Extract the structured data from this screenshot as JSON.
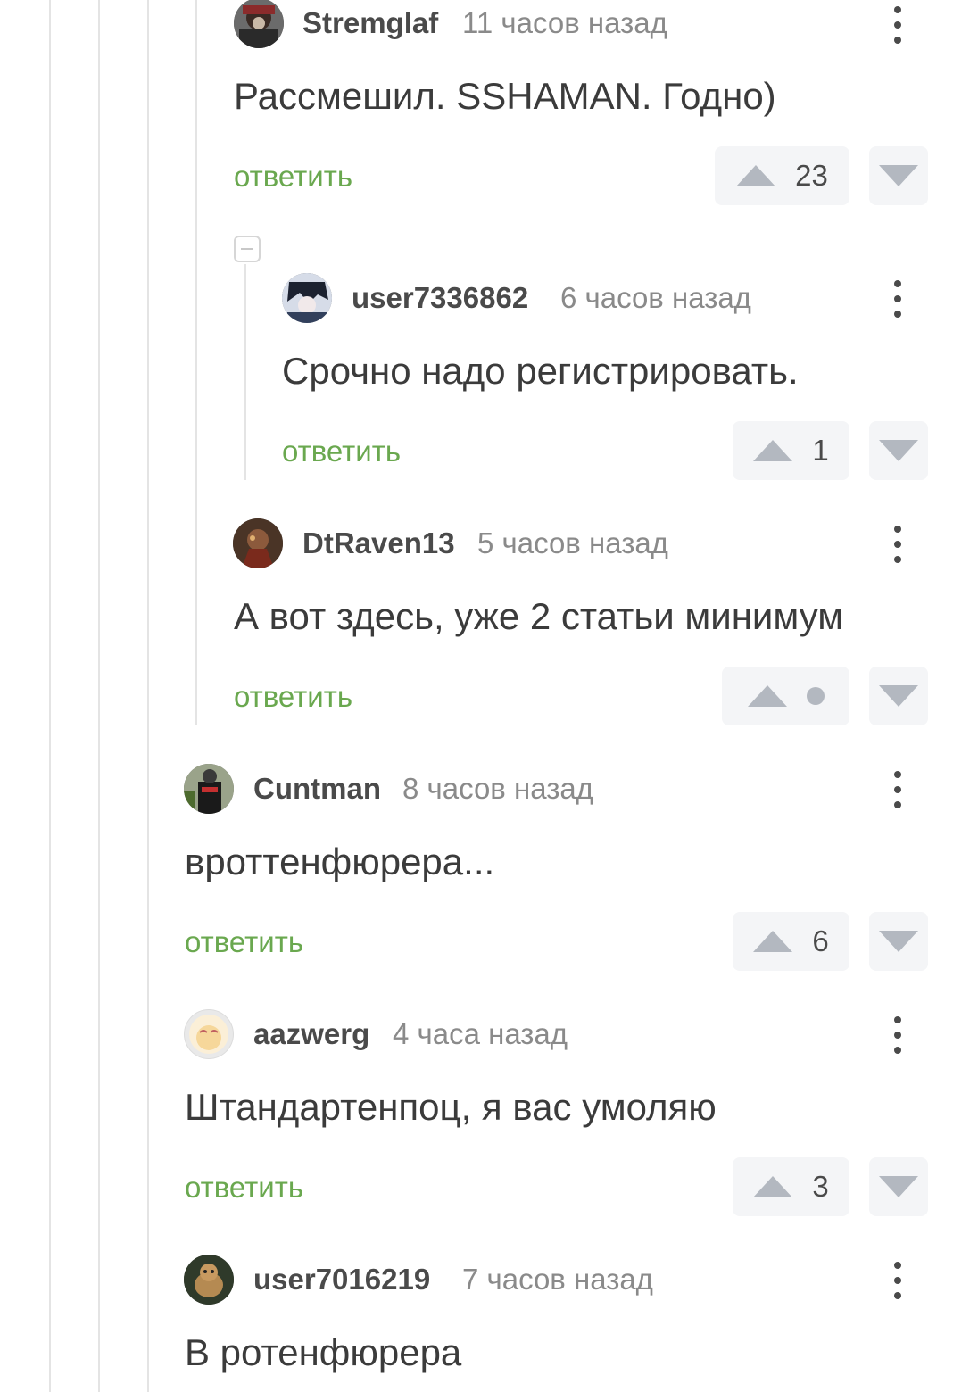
{
  "comments": [
    {
      "author": "Stremglaf",
      "time": "11 часов назад",
      "text": "Рассмешил. SSHAMAN. Годно)",
      "reply": "ответить",
      "score": "23"
    },
    {
      "author": "user7336862",
      "time": "6 часов назад",
      "text": "Срочно надо регистрировать.",
      "reply": "ответить",
      "score": "1"
    },
    {
      "author": "DtRaven13",
      "time": "5 часов назад",
      "text": "А вот здесь, уже 2 статьи минимум",
      "reply": "ответить",
      "score": ""
    },
    {
      "author": "Cuntman",
      "time": "8 часов назад",
      "text": "вроттенфюрера...",
      "reply": "ответить",
      "score": "6"
    },
    {
      "author": "aazwerg",
      "time": "4 часа назад",
      "text": "Штандартенпоц, я вас умоляю",
      "reply": "ответить",
      "score": "3"
    },
    {
      "author": "user7016219",
      "time": "7 часов назад",
      "text": "В ротенфюрера"
    }
  ],
  "colors": {
    "reply_link": "#6aa84f",
    "vote_bg": "#f4f5f7",
    "vote_arrow": "#b3b8c0",
    "thread_line": "#e4e4e4"
  }
}
